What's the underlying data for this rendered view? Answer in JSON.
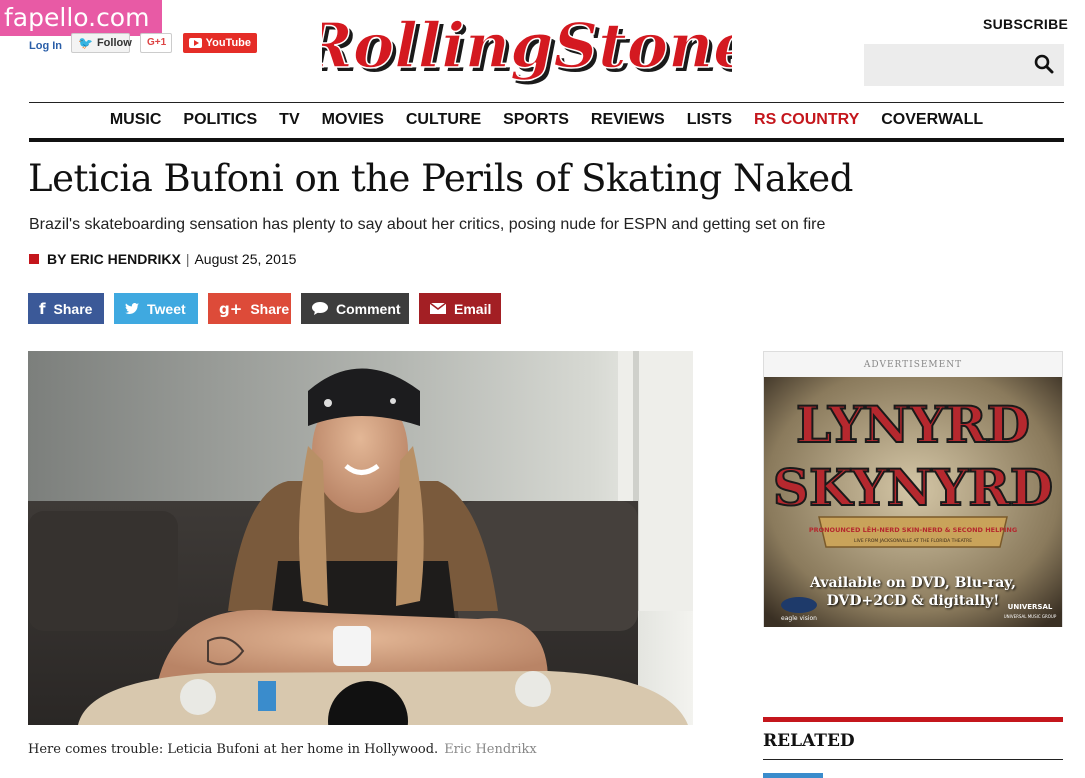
{
  "watermark": "fapello.com",
  "header": {
    "login": "Log In",
    "twitter_follow": "Follow",
    "gplus": "G+1",
    "youtube": "YouTube",
    "logo": "RollingStone",
    "subscribe": "SUBSCRIBE",
    "search_placeholder": ""
  },
  "nav": {
    "items": [
      {
        "label": "MUSIC"
      },
      {
        "label": "POLITICS"
      },
      {
        "label": "TV"
      },
      {
        "label": "MOVIES"
      },
      {
        "label": "CULTURE"
      },
      {
        "label": "SPORTS"
      },
      {
        "label": "REVIEWS"
      },
      {
        "label": "LISTS"
      },
      {
        "label": "RS COUNTRY",
        "accent": "#c4161c"
      },
      {
        "label": "COVERWALL"
      }
    ]
  },
  "article": {
    "headline": "Leticia Bufoni on the Perils of Skating Naked",
    "dek": "Brazil's skateboarding sensation has plenty to say about her critics, posing nude for ESPN and getting set on fire",
    "byline_prefix": "BY",
    "author": "ERIC HENDRIKX",
    "date": "August 25, 2015",
    "caption": "Here comes trouble: Leticia Bufoni at her home in Hollywood.",
    "photo_credit": "Eric Hendrikx"
  },
  "share": {
    "facebook": "Share",
    "twitter": "Tweet",
    "googleplus": "Share",
    "comment": "Comment",
    "email": "Email"
  },
  "sidebar": {
    "ad_label": "ADVERTISEMENT",
    "ad_headline_1": "LYNYRD",
    "ad_headline_2": "SKYNYRD",
    "ad_banner": "PRONOUNCED LĔH-NERD SKIN-NERD & SECOND HELPING",
    "ad_banner_small": "LIVE FROM JACKSONVILLE AT THE FLORIDA THEATRE",
    "ad_availability_1": "Available on DVD, Blu-ray,",
    "ad_availability_2": "DVD+2CD & digitally!",
    "ad_brand_left": "eagle vision",
    "ad_brand_right": "UNIVERSAL",
    "ad_brand_right_small": "UNIVERSAL MUSIC GROUP",
    "related_title": "RELATED"
  },
  "colors": {
    "brand_red": "#c4161c",
    "facebook": "#3b5998",
    "twitter": "#3fa9e0",
    "googleplus": "#dd4b39",
    "comment": "#3d3d3d",
    "email": "#a31f24"
  }
}
